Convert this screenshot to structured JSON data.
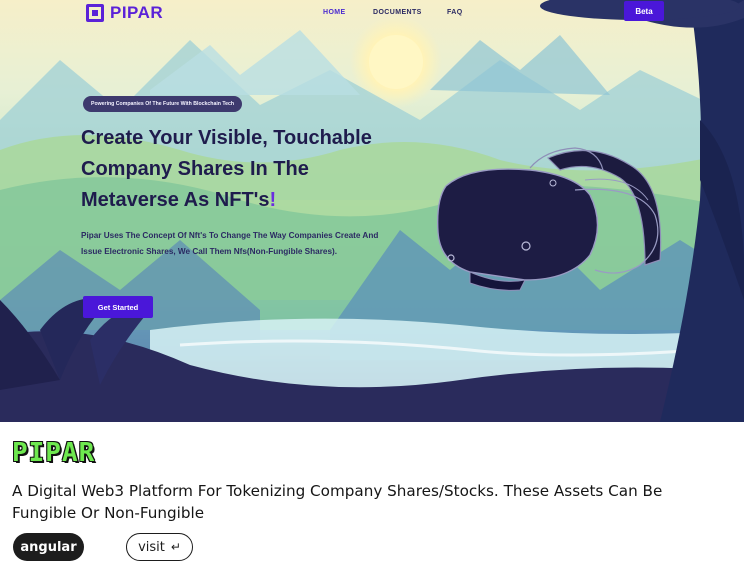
{
  "nav": {
    "logo_text": "PIPAR",
    "links": [
      "HOME",
      "DOCUMENTS",
      "FAQ"
    ],
    "beta_label": "Beta"
  },
  "hero": {
    "badge": "Powering Companies Of The Future With Blockchain Tech",
    "headline_line1": "Create Your Visible, Touchable",
    "headline_line2": "Company Shares In The",
    "headline_line3_main": "Metaverse As NFT's",
    "headline_line3_accent": "!",
    "subtext": "Pipar Uses The Concept Of Nft's To Change The Way Companies Create And Issue Electronic Shares, We Call Them Nfs(Non-Fungible Shares).",
    "cta_label": "Get Started"
  },
  "project": {
    "title": "PIPAR",
    "description": "A Digital Web3 Platform For Tokenizing Company Shares/Stocks. These Assets Can Be Fungible Or Non-Fungible",
    "tag": "angular",
    "visit_label": "visit",
    "visit_icon": "↵"
  },
  "colors": {
    "brand_purple": "#4a17d9",
    "title_green": "#6ee84f",
    "navy": "#1f1c4d"
  },
  "icons": {
    "logo": "logo-mark-icon",
    "visit": "return-arrow-icon",
    "vr_headset": "vr-headset-illustration"
  }
}
